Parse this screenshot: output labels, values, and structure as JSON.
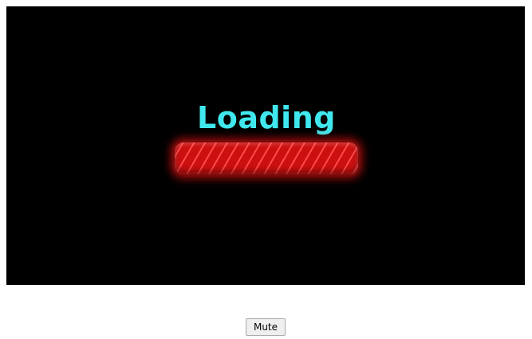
{
  "game": {
    "loading_text": "Loading",
    "loading_text_color": "#40e8ee",
    "background_color": "#000000",
    "progress": {
      "fraction": 1.0,
      "color": "#d01818"
    }
  },
  "controls": {
    "mute_label": "Mute"
  }
}
